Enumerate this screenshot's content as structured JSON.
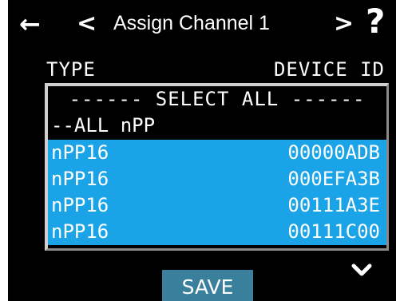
{
  "header": {
    "back_icon": "←",
    "prev_icon": "<",
    "title": "Assign Channel 1",
    "next_icon": ">",
    "help_icon": "?"
  },
  "columns": {
    "type": "TYPE",
    "device_id": "DEVICE ID"
  },
  "list": {
    "select_all": "------ SELECT ALL ------",
    "all_group": "--ALL nPP",
    "devices": [
      {
        "type": "nPP16",
        "device_id": "00000ADB"
      },
      {
        "type": "nPP16",
        "device_id": "000EFA3B"
      },
      {
        "type": "nPP16",
        "device_id": "00111A3E"
      },
      {
        "type": "nPP16",
        "device_id": "00111C00"
      }
    ]
  },
  "footer": {
    "scroll_icon": "chevron-down",
    "save_label": "SAVE"
  },
  "colors": {
    "background": "#000000",
    "highlight": "#1aa3e6",
    "save_button": "#3a7f9c",
    "text": "#ffffff"
  }
}
